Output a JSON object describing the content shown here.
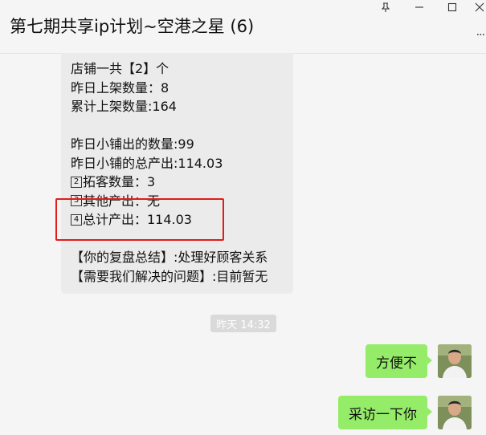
{
  "window": {
    "title": "第七期共享ip计划~空港之星 (6)",
    "controls": {
      "pin": "⊥",
      "minimize": "—",
      "maximize": "☐",
      "close": "✕"
    },
    "more": "···"
  },
  "message_in": {
    "shop_count": "店铺一共【2】个",
    "yesterday_listed": "昨日上架数量：8",
    "total_listed": "累计上架数量:164",
    "yesterday_shop_out": "昨日小铺出的数量:99",
    "yesterday_shop_total": "昨日小铺的总产出:114.03",
    "item2_num": "2",
    "item2_text": "拓客数量：3",
    "item3_num": "3",
    "item3_text": "其他产出：无",
    "item4_num": "4",
    "item4_text": "总计产出：114.03",
    "review": "【你的复盘总结】:处理好顾客关系",
    "problem": "【需要我们解决的问题】:目前暂无"
  },
  "timestamp": "昨天 14:32",
  "messages_out": [
    {
      "text": "方便不"
    },
    {
      "text": "采访一下你"
    }
  ],
  "colors": {
    "highlight_box": "#e21b1b",
    "outgoing_bubble": "#95ec69",
    "incoming_bubble": "#ebebeb"
  }
}
